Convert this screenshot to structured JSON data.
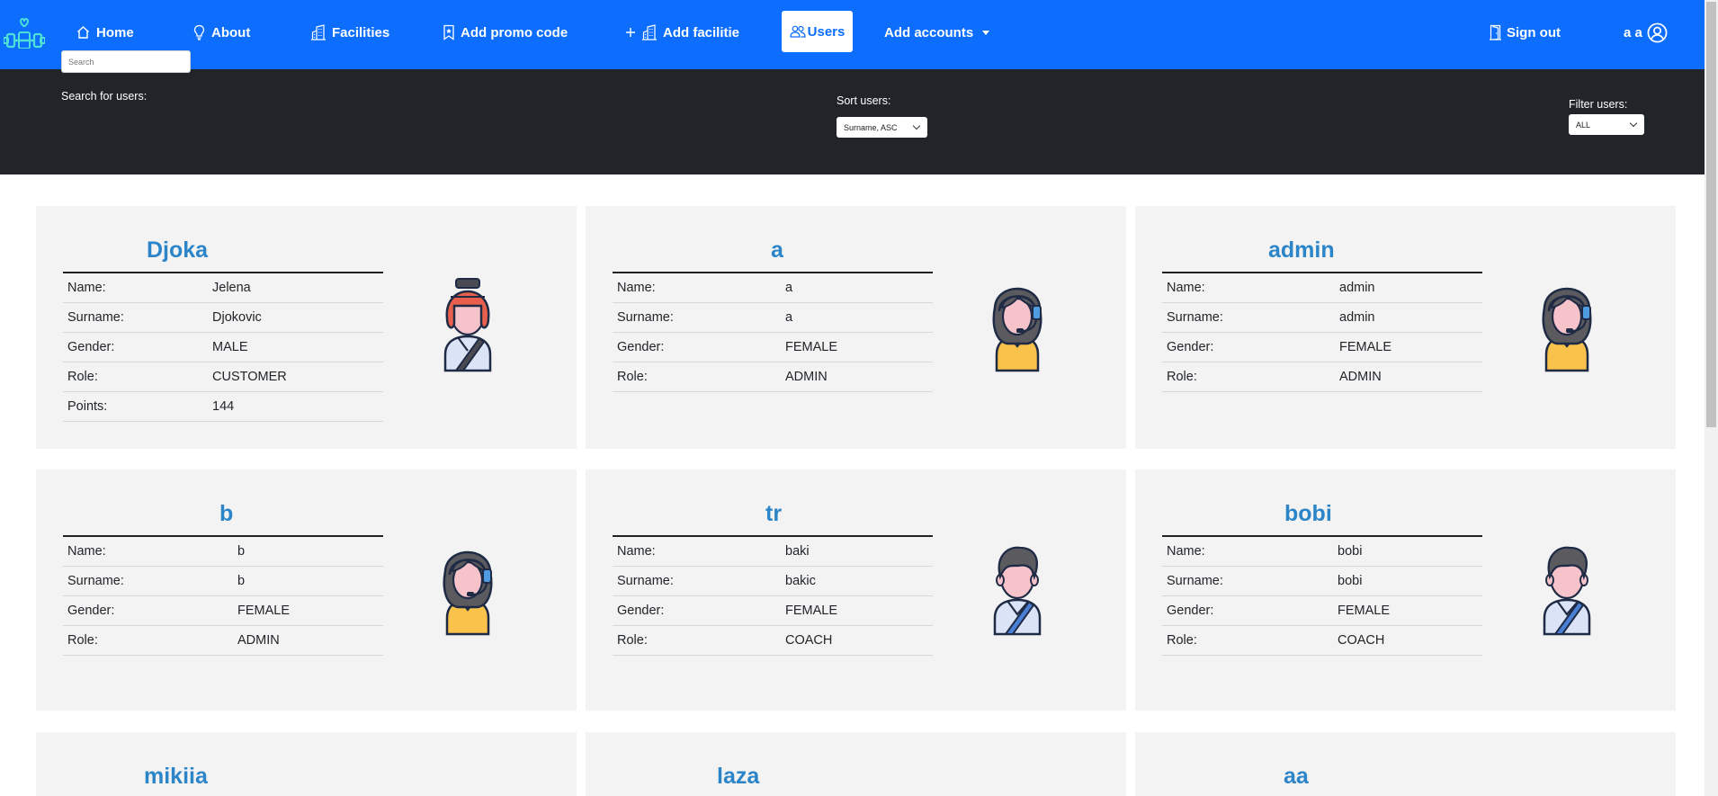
{
  "nav": {
    "home": "Home",
    "about": "About",
    "facilities": "Facilities",
    "promo": "Add promo code",
    "add_facility": "Add facilitie",
    "users": "Users",
    "add_accounts": "Add accounts",
    "sign_out": "Sign out",
    "user_initials": "a a"
  },
  "toolbar": {
    "search_label": "Search for users:",
    "search_placeholder": "Search",
    "sort_label": "Sort users:",
    "sort_value": "Surname, ASC",
    "filter_label": "Filter users:",
    "filter_value": "ALL"
  },
  "labels": {
    "name": "Name:",
    "surname": "Surname:",
    "gender": "Gender:",
    "role": "Role:",
    "points": "Points:"
  },
  "users": [
    {
      "username": "Djoka",
      "name": "Jelena",
      "surname": "Djokovic",
      "gender": "MALE",
      "role": "CUSTOMER",
      "points": "144",
      "avatar": "customer-helmet-icon"
    },
    {
      "username": "a",
      "name": "a",
      "surname": "a",
      "gender": "FEMALE",
      "role": "ADMIN",
      "avatar": "admin-headset-icon"
    },
    {
      "username": "admin",
      "name": "admin",
      "surname": "admin",
      "gender": "FEMALE",
      "role": "ADMIN",
      "avatar": "admin-headset-icon"
    },
    {
      "username": "b",
      "name": "b",
      "surname": "b",
      "gender": "FEMALE",
      "role": "ADMIN",
      "avatar": "admin-headset-icon"
    },
    {
      "username": "tr",
      "name": "baki",
      "surname": "bakic",
      "gender": "FEMALE",
      "role": "COACH",
      "avatar": "coach-icon"
    },
    {
      "username": "bobi",
      "name": "bobi",
      "surname": "bobi",
      "gender": "FEMALE",
      "role": "COACH",
      "avatar": "coach-icon"
    },
    {
      "username": "mikiia"
    },
    {
      "username": "laza"
    },
    {
      "username": "aa"
    }
  ],
  "colors": {
    "navbar": "#0d6efd",
    "filterbar": "#212529",
    "card_bg": "#f3f3f3",
    "username": "#2b85c8"
  }
}
